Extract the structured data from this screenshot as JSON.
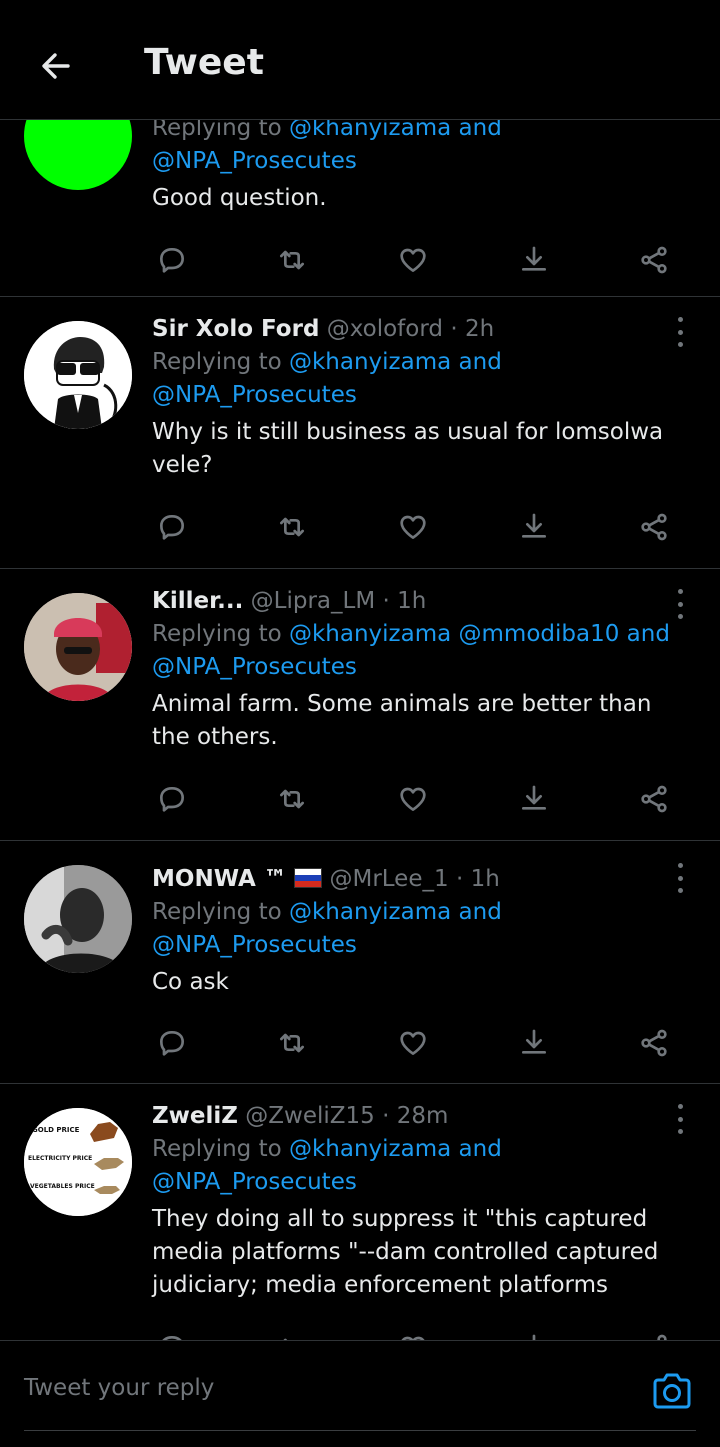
{
  "header": {
    "title": "Tweet"
  },
  "tweets": [
    {
      "name": "",
      "handle": "",
      "time": "",
      "reply_label": "Replying to",
      "mentions_line1": "@khanyizama and",
      "mentions_line2": "@NPA_Prosecutes",
      "text": "Good question.",
      "avatar": "green-circle"
    },
    {
      "name": "Sir Xolo Ford",
      "handle": "@xoloford",
      "time": "2h",
      "reply_label": "Replying to",
      "mentions_line1": "@khanyizama and",
      "mentions_line2": "@NPA_Prosecutes",
      "text": "Why is it still business as usual for lomsolwa vele?",
      "avatar": "cartoon-sunglasses"
    },
    {
      "name": "Killer...",
      "handle": "@Lipra_LM",
      "time": "1h",
      "reply_label": "Replying to",
      "mentions_line1": "@khanyizama @mmodiba10 and",
      "mentions_line2": "@NPA_Prosecutes",
      "text": "Animal farm. Some animals are better than the others.",
      "avatar": "man-red-cap"
    },
    {
      "name": "MONWA ™",
      "handle": "@MrLee_1",
      "time": "1h",
      "reply_label": "Replying to",
      "mentions_line1": "@khanyizama and",
      "mentions_line2": "@NPA_Prosecutes",
      "text": "Co ask",
      "avatar": "man-grayscale"
    },
    {
      "name": "ZweliZ",
      "handle": "@ZweliZ15",
      "time": "28m",
      "reply_label": "Replying to",
      "mentions_line1": "@khanyizama and",
      "mentions_line2": "@NPA_Prosecutes",
      "text": "They doing all to suppress it \"this captured media platforms \"--dam controlled captured judiciary; media  enforcement platforms",
      "avatar": "price-horses",
      "avatar_labels": [
        "GOLD PRICE",
        "ELECTRICITY PRICE",
        "VEGETABLES PRICE"
      ]
    }
  ],
  "composer": {
    "placeholder": "Tweet your reply"
  },
  "icons": [
    "back-arrow-icon",
    "reply-icon",
    "retweet-icon",
    "like-icon",
    "download-icon",
    "share-icon",
    "more-icon",
    "camera-icon"
  ],
  "colors": {
    "accent": "#1d9bf0",
    "muted": "#71767b",
    "background": "#000000"
  }
}
